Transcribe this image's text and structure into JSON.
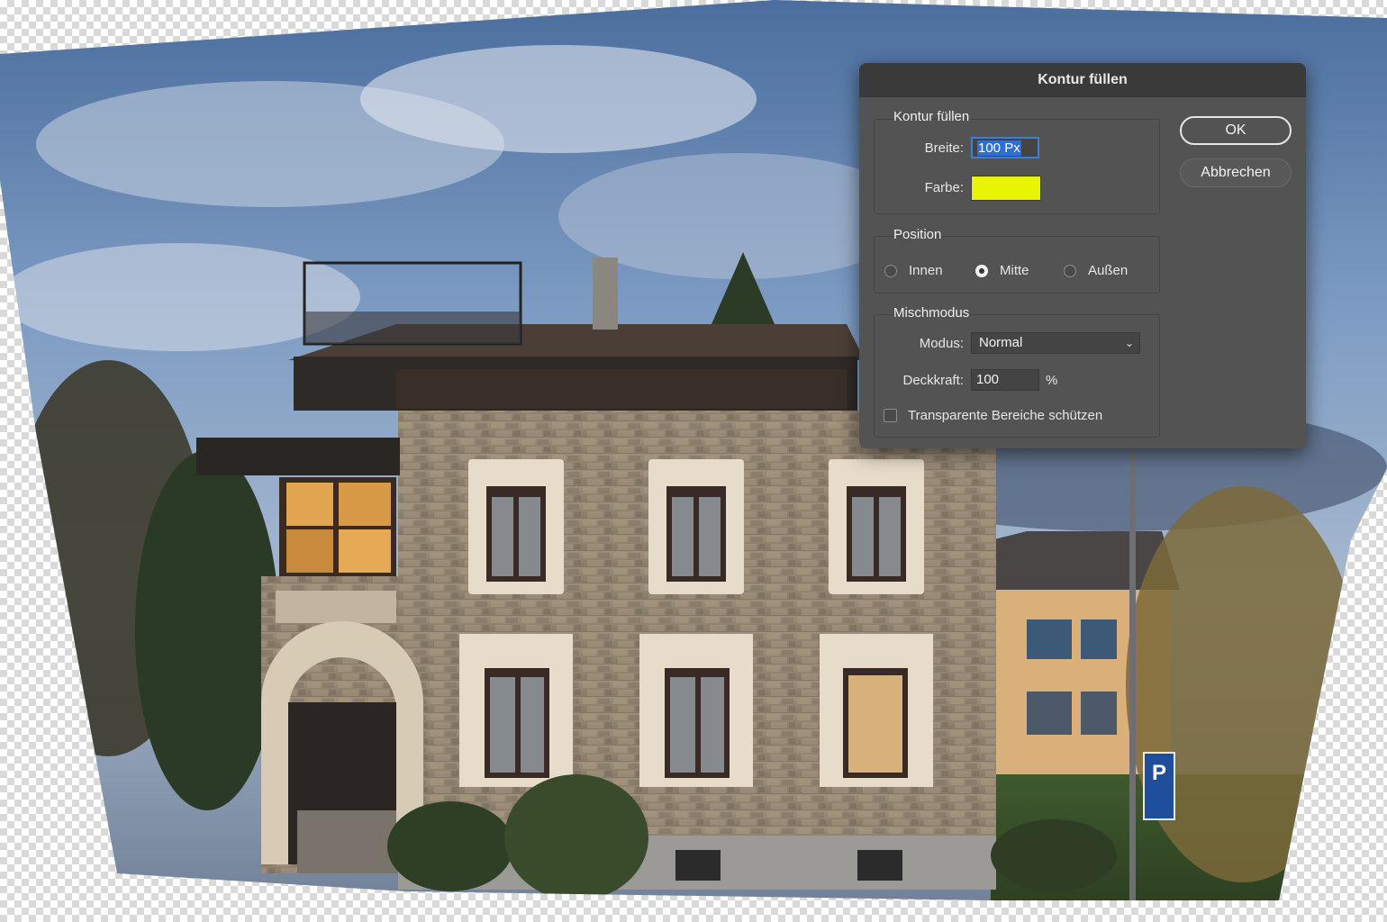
{
  "dialog": {
    "title": "Kontur füllen",
    "stroke_group": {
      "label": "Kontur füllen",
      "width_label": "Breite:",
      "width_value": "100 Px",
      "color_label": "Farbe:",
      "color": "#e8f400"
    },
    "position_group": {
      "label": "Position",
      "options": [
        {
          "label": "Innen",
          "selected": false
        },
        {
          "label": "Mitte",
          "selected": true
        },
        {
          "label": "Außen",
          "selected": false
        }
      ]
    },
    "blend_group": {
      "label": "Mischmodus",
      "mode_label": "Modus:",
      "mode_value": "Normal",
      "opacity_label": "Deckkraft:",
      "opacity_value": "100",
      "opacity_unit": "%",
      "preserve_transparency_label": "Transparente Bereiche schützen",
      "preserve_transparency_checked": false
    },
    "ok_label": "OK",
    "cancel_label": "Abbrechen"
  },
  "icons": {
    "select_chevron": "chevron-down-icon"
  }
}
